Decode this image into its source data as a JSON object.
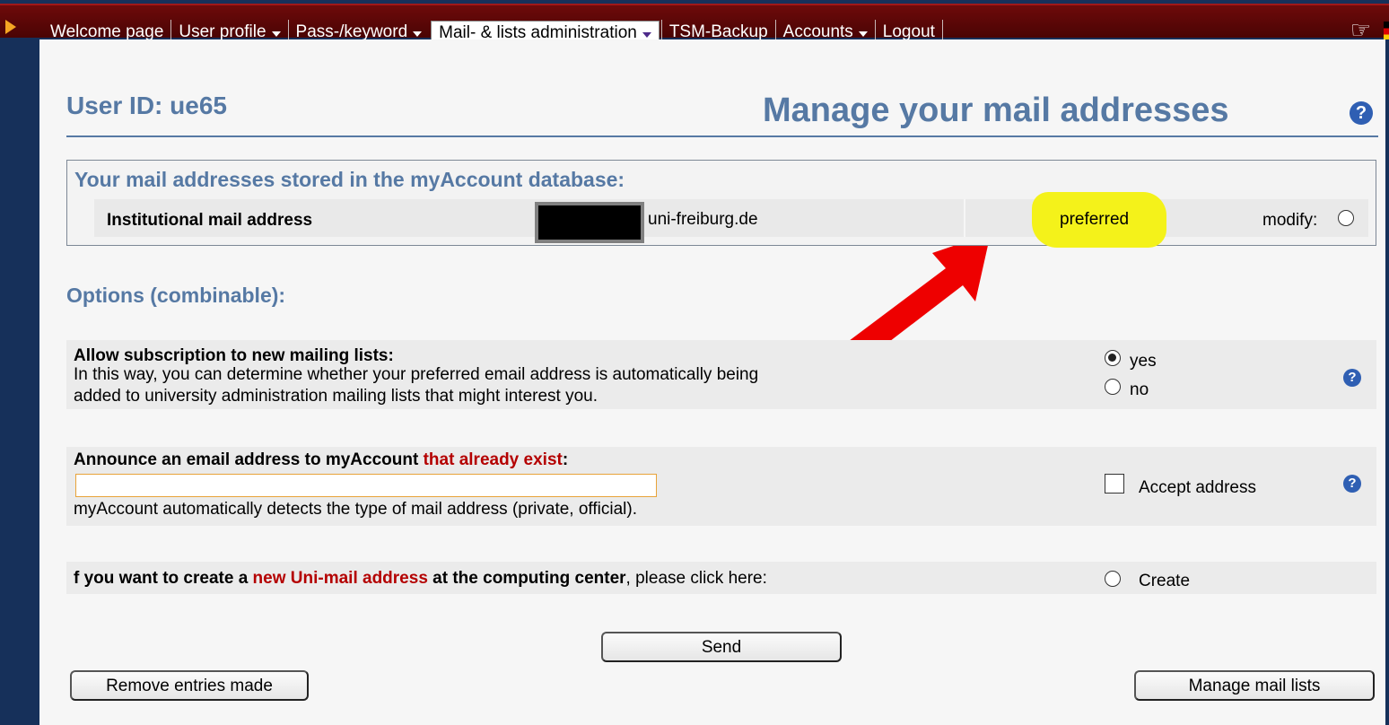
{
  "nav": {
    "items": [
      {
        "label": "Welcome page",
        "dropdown": false
      },
      {
        "label": "User profile",
        "dropdown": true
      },
      {
        "label": "Pass-/keyword",
        "dropdown": true
      },
      {
        "label": "Mail- & lists administration",
        "dropdown": true,
        "active": true
      },
      {
        "label": "TSM-Backup",
        "dropdown": false
      },
      {
        "label": "Accounts",
        "dropdown": true
      },
      {
        "label": "Logout",
        "dropdown": false
      }
    ]
  },
  "header": {
    "user_id": "User ID: ue65",
    "title": "Manage your mail addresses",
    "help": "?"
  },
  "database": {
    "heading": "Your mail addresses stored in the myAccount database:",
    "row": {
      "label": "Institutional mail address",
      "domain": "uni-freiburg.de",
      "status": "preferred",
      "modify_label": "modify:"
    }
  },
  "options": {
    "heading": "Options (combinable):",
    "subscription": {
      "title": "Allow subscription to new mailing lists:",
      "desc1": "In this way, you can determine whether your preferred email address is automatically being",
      "desc2": "added to university administration mailing lists that might interest you.",
      "yes_label": "yes",
      "no_label": "no",
      "selected": "yes",
      "help": "?"
    },
    "announce": {
      "title_start": "Announce an email address to myAccount ",
      "title_red": "that already exist",
      "title_end": ":",
      "input_value": "",
      "desc": "myAccount automatically detects the type of mail address (private, official).",
      "checkbox_label": "Accept address",
      "help": "?"
    },
    "create": {
      "text_start": "f you want to create a ",
      "text_red": "new Uni-mail address",
      "text_mid": " at the computing center",
      "text_end": ", please click here:",
      "radio_label": "Create"
    }
  },
  "buttons": {
    "send": "Send",
    "remove": "Remove entries made",
    "manage": "Manage mail lists"
  },
  "colors": {
    "nav_bg": "#5a0606",
    "frame": "#16305a",
    "accent": "#5679a4",
    "highlight": "#f4f21a",
    "arrow": "#ee0000",
    "red_text": "#b40000"
  }
}
